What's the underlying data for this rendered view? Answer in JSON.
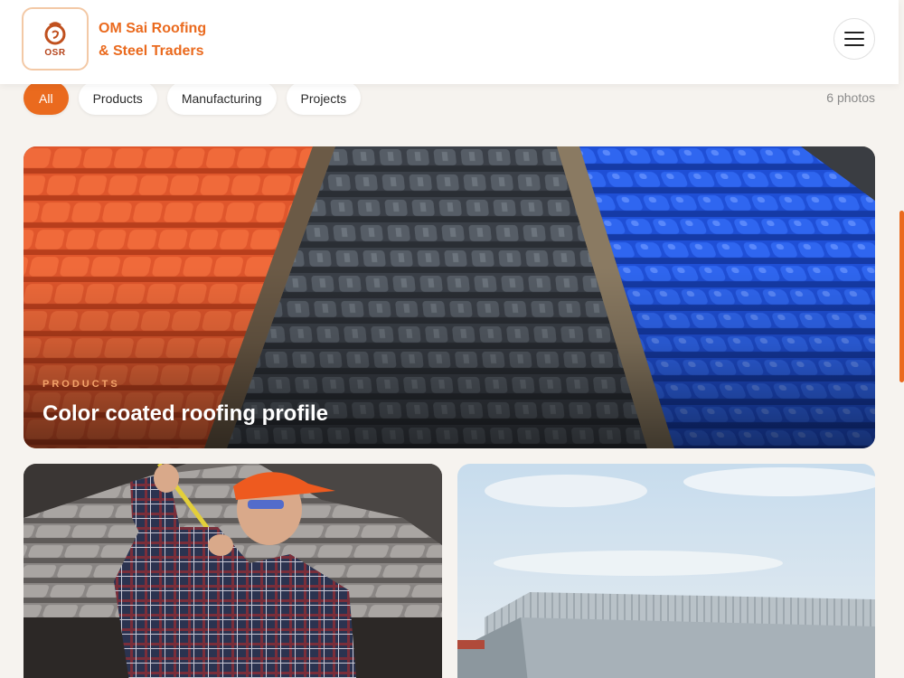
{
  "brand": {
    "line1": "OM Sai Roofing",
    "line2": "& Steel Traders",
    "logo_text": "OSR"
  },
  "filters": {
    "all": "All",
    "products": "Products",
    "manufacturing": "Manufacturing",
    "projects": "Projects"
  },
  "photo_count": "6 photos",
  "gallery": [
    {
      "category": "PRODUCTS",
      "title": "Color coated roofing profile",
      "image": "roof-tiles-orange-grey-blue"
    },
    {
      "image": "worker-measuring-roof"
    },
    {
      "image": "industrial-shed-roof"
    }
  ],
  "colors": {
    "accent": "#ea6a1e",
    "background": "#f6f3ef"
  }
}
